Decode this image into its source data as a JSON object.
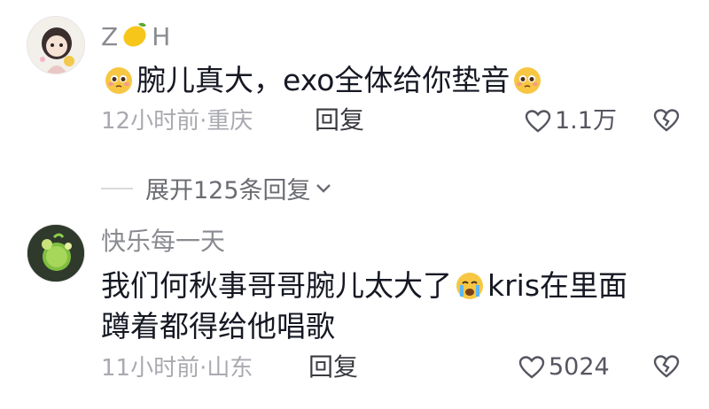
{
  "comments": [
    {
      "username_prefix": "Z",
      "username_suffix": "H",
      "username_emoji": "lemon-icon",
      "text": "腕儿真大，exo全体给你垫音",
      "time": "12小时前",
      "location": "重庆",
      "reply_label": "回复",
      "likes": "1.1万"
    },
    {
      "username": "快乐每一天",
      "text_line1": "我们何秋事哥哥腕儿太大了",
      "text_line1_after": "kris在里面",
      "text_line2": "蹲着都得给他唱歌",
      "time": "11小时前",
      "location": "山东",
      "reply_label": "回复",
      "likes": "5024"
    }
  ],
  "expand_replies": "展开125条回复",
  "colors": {
    "muted": "#a9aab0",
    "text": "#161823",
    "name": "#8a8b91"
  }
}
